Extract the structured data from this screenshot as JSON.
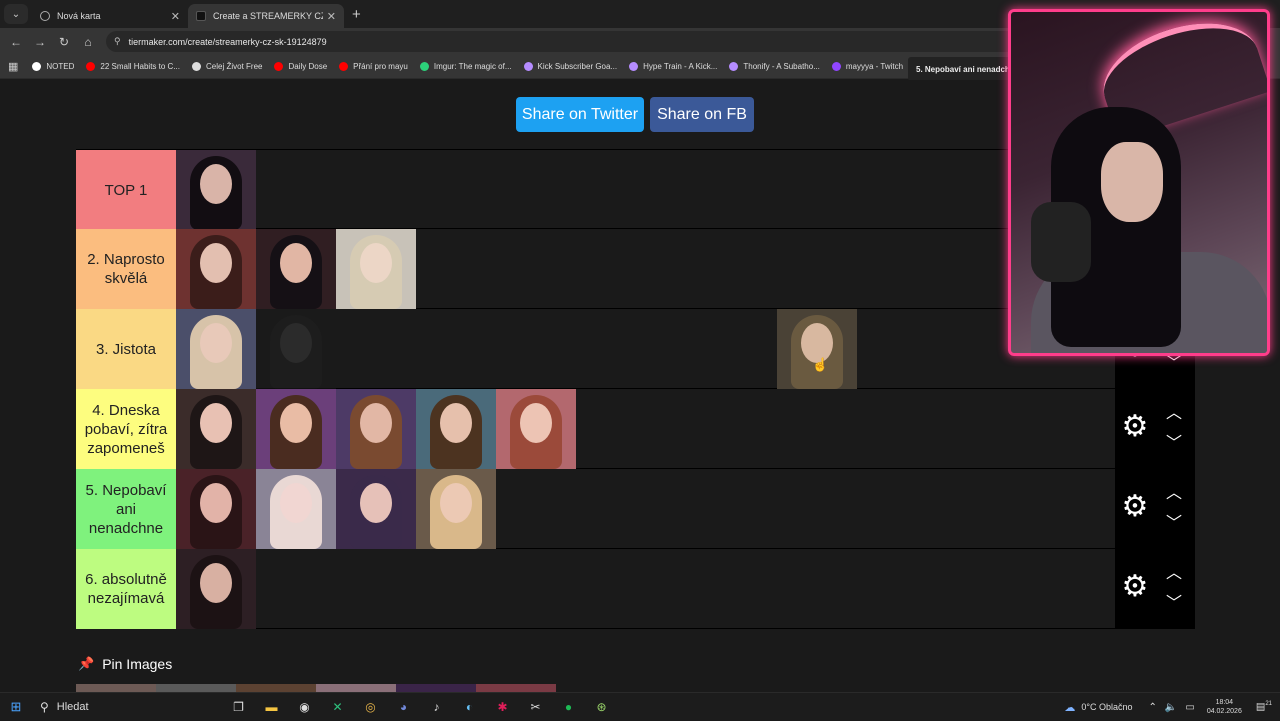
{
  "browser": {
    "tabs": [
      {
        "label": "Nová karta",
        "active": false
      },
      {
        "label": "Create a STREAMERKY CZ/SK T",
        "active": true
      }
    ],
    "url": "tiermaker.com/create/streamerky-cz-sk-19124879",
    "bookmarks": [
      {
        "label": "NOTED",
        "color": "#ffffff"
      },
      {
        "label": "22 Small Habits to C...",
        "color": "#ff0000"
      },
      {
        "label": "Celej Život Free",
        "color": "#dddddd"
      },
      {
        "label": "Daily Dose",
        "color": "#ff0000"
      },
      {
        "label": "Přání pro mayu",
        "color": "#ff0000"
      },
      {
        "label": "Imgur: The magic of...",
        "color": "#2cd17a"
      },
      {
        "label": "Kick Subscriber Goa...",
        "color": "#b58cff"
      },
      {
        "label": "Hype Train - A Kick...",
        "color": "#b58cff"
      },
      {
        "label": "Thonify - A Subatho...",
        "color": "#b58cff"
      },
      {
        "label": "mayyya - Twitch",
        "color": "#9146ff"
      }
    ],
    "bookmark_tooltip": "5. Nepobaví ani nenadchne"
  },
  "share": {
    "twitter": "Share on Twitter",
    "fb": "Share on FB"
  },
  "tiers": [
    {
      "label": "TOP 1",
      "color": "#f27d80",
      "items": 1
    },
    {
      "label": "2. Naprosto skvělá",
      "color": "#fbbd7f",
      "items": 3
    },
    {
      "label": "3. Jistota",
      "color": "#fad984",
      "items": 2
    },
    {
      "label": "4. Dneska pobaví, zítra zapomeneš",
      "color": "#fdfd7f",
      "items": 5
    },
    {
      "label": "5. Nepobaví ani nenadchne",
      "color": "#7ff27d",
      "items": 4
    },
    {
      "label": "6. absolutně nezajímavá",
      "color": "#bdfc80",
      "items": 1
    }
  ],
  "pin": {
    "title": "Pin Images"
  },
  "taskbar": {
    "search": "Hledat",
    "weather": "0°C Oblačno",
    "time": "18:04",
    "date": "04.02.2026",
    "notifications": "21"
  }
}
